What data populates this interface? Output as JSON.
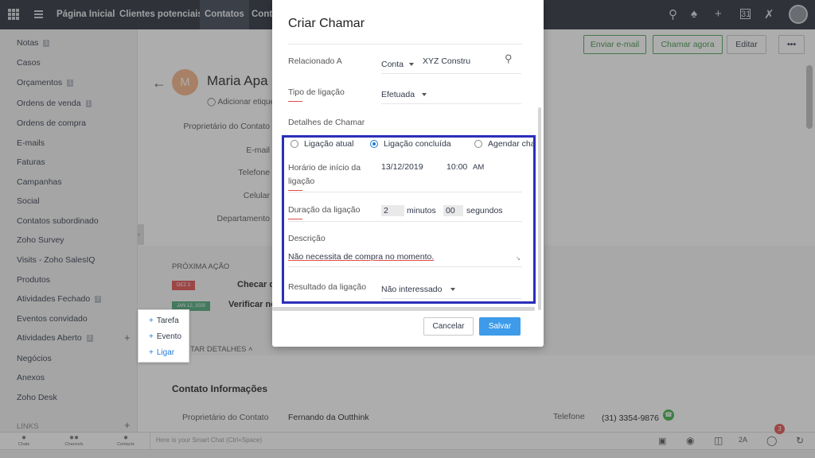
{
  "topbar": {
    "tabs": [
      "Página Inicial",
      "Clientes potenciais",
      "Contatos",
      "Conta"
    ],
    "icons": [
      "search-icon",
      "bell-icon",
      "plus-icon",
      "calendar-icon",
      "tools-icon"
    ]
  },
  "sidebar": {
    "items": [
      {
        "label": "Notas",
        "badge": "1"
      },
      {
        "label": "Casos",
        "badge": ""
      },
      {
        "label": "Orçamentos",
        "badge": "1"
      },
      {
        "label": "Ordens de venda",
        "badge": "1"
      },
      {
        "label": "Ordens de compra",
        "badge": ""
      },
      {
        "label": "E-mails",
        "badge": ""
      },
      {
        "label": "Faturas",
        "badge": ""
      },
      {
        "label": "Campanhas",
        "badge": ""
      },
      {
        "label": "Social",
        "badge": ""
      },
      {
        "label": "Contatos subordinado",
        "badge": ""
      },
      {
        "label": "Zoho Survey",
        "badge": ""
      },
      {
        "label": "Visits - Zoho SalesIQ",
        "badge": ""
      },
      {
        "label": "Produtos",
        "badge": ""
      },
      {
        "label": "Atividades Fechado",
        "badge": "7"
      },
      {
        "label": "Eventos convidado",
        "badge": ""
      },
      {
        "label": "Atividades Aberto",
        "badge": "2"
      },
      {
        "label": "Negócios",
        "badge": ""
      },
      {
        "label": "Anexos",
        "badge": ""
      },
      {
        "label": "Zoho Desk",
        "badge": ""
      }
    ],
    "links_label": "LINKS"
  },
  "popmenu": {
    "items": [
      "Tarefa",
      "Evento",
      "Ligar"
    ]
  },
  "record": {
    "initial": "M",
    "name": "Maria Apa",
    "tag_label": "Adicionar etique",
    "fields": [
      "Proprietário do Contato",
      "E-mail",
      "Telefone",
      "Celular",
      "Departamento"
    ],
    "next_action_label": "PRÓXIMA AÇÃO",
    "actions": [
      {
        "date": "DEZ 3",
        "title": "Checar com di"
      },
      {
        "date": "JAN 12, 2020",
        "title": "Verificar ne"
      }
    ],
    "details_toggle": "TAR DETALHES",
    "section_title": "Contato Informações",
    "owner_label": "Proprietário do Contato",
    "owner_value": "Fernando da Outthink",
    "phone_label": "Telefone",
    "phone_value": "(31) 3354-9876"
  },
  "actions_bar": {
    "email": "Enviar e-mail",
    "call_now": "Chamar agora",
    "edit": "Editar",
    "more": "•••"
  },
  "modal": {
    "title": "Criar Chamar",
    "related_label": "Relacionado A",
    "related_module": "Conta",
    "related_value": "XYZ Constru",
    "call_type_label": "Tipo de ligação",
    "call_type_value": "Efetuada",
    "details_header": "Detalhes de Chamar",
    "radios": [
      "Ligação atual",
      "Ligação concluída",
      "Agendar cha"
    ],
    "start_label_1": "Horário de início da",
    "start_label_2": "ligação",
    "start_date": "13/12/2019",
    "start_time": "10:00",
    "start_ampm": "AM",
    "duration_label": "Duração da ligação",
    "duration_minutes": "2",
    "minutes_label": "minutos",
    "duration_seconds": "00",
    "seconds_label": "segundos",
    "description_label": "Descrição",
    "description_value": "Não necessita de compra no momento.",
    "result_label": "Resultado da ligação",
    "result_value": "Não interessado",
    "cancel": "Cancelar",
    "save": "Salvar"
  },
  "bottombar": {
    "items": [
      "Chats",
      "Channels",
      "Contacts"
    ],
    "placeholder": "Here is your Smart Chat (Ctrl+Space)",
    "notification_count": "3"
  }
}
